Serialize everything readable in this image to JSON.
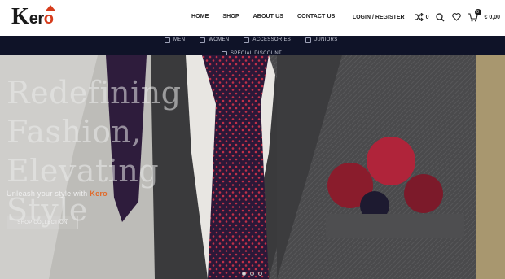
{
  "logo": {
    "k": "K",
    "rest": "er",
    "o": "o"
  },
  "nav": [
    {
      "label": "HOME"
    },
    {
      "label": "SHOP"
    },
    {
      "label": "ABOUT US"
    },
    {
      "label": "CONTACT US"
    }
  ],
  "header_tools": {
    "login_label": "LOGIN / REGISTER",
    "compare_count": "0",
    "cart_count": "0",
    "cart_total": "€ 0,00",
    "icons": [
      "shuffle-icon",
      "search-icon",
      "heart-icon",
      "cart-icon"
    ]
  },
  "subnav": {
    "items": [
      {
        "label": "MEN",
        "icon": "menu-grid-icon"
      },
      {
        "label": "WOMEN",
        "icon": "menu-grid-icon"
      },
      {
        "label": "ACCESSORIES",
        "icon": "menu-grid-icon"
      },
      {
        "label": "JUNIORS",
        "icon": "menu-grid-icon"
      }
    ],
    "special": {
      "label": "SPECIAL DISCOUNT",
      "icon": "menu-grid-icon"
    }
  },
  "hero": {
    "headline_lines": [
      "Redefining",
      "Fashion,",
      "Elevating Style"
    ],
    "tagline_prefix": "Unleash your style with",
    "tagline_brand": "Kero",
    "cta_label": "SHOP COLLECTION",
    "slides": 3,
    "active_slide": 1
  },
  "colors": {
    "accent": "#d63c1c",
    "subnav_bg": "#0f1328",
    "brand_highlight": "#e06b2c"
  }
}
